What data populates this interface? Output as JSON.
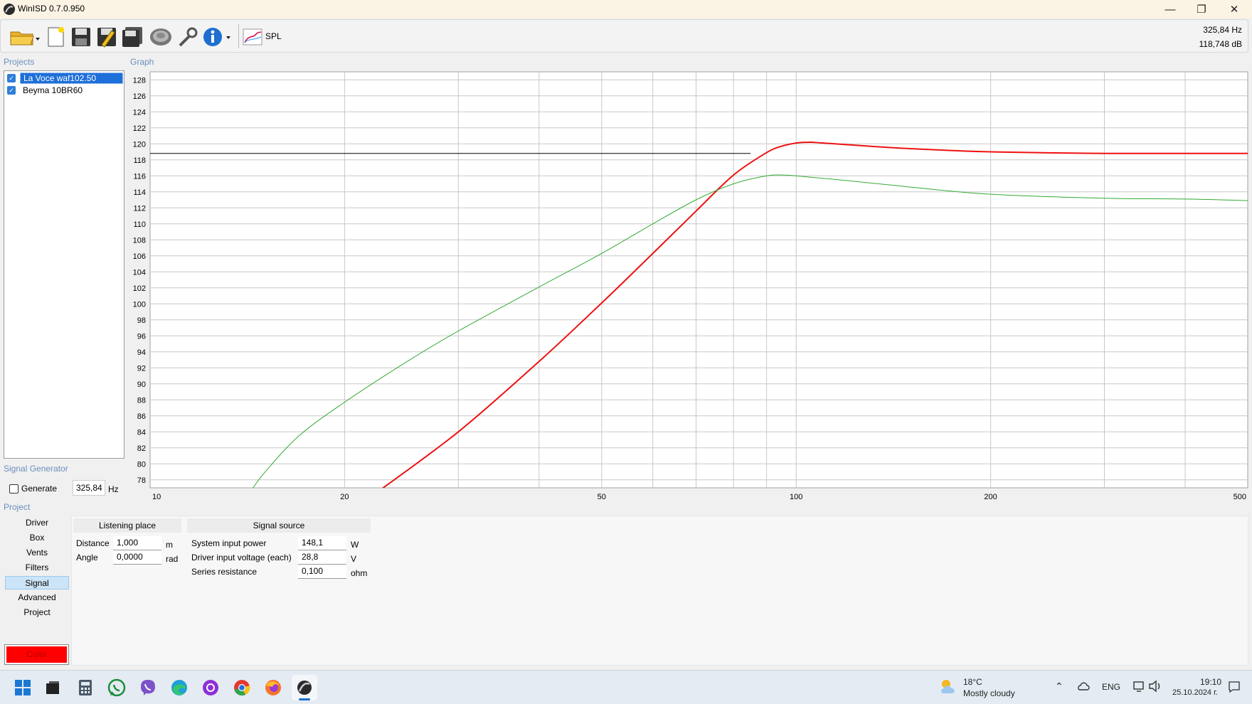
{
  "window": {
    "title": "WinISD 0.7.0.950"
  },
  "toolbar": {
    "spl_label": "SPL",
    "readout_hz": "325,84 Hz",
    "readout_db": "118,748 dB"
  },
  "sections": {
    "projects": "Projects",
    "graph": "Graph",
    "signal_generator": "Signal Generator",
    "project": "Project"
  },
  "projects": [
    {
      "name": "La Voce waf102.50",
      "checked": true,
      "selected": true
    },
    {
      "name": "Beyma 10BR60",
      "checked": true,
      "selected": false
    }
  ],
  "signal_generator": {
    "generate_label": "Generate",
    "frequency": "325,84",
    "unit": "Hz"
  },
  "nav": {
    "items": [
      "Driver",
      "Box",
      "Vents",
      "Filters",
      "Signal",
      "Advanced",
      "Project"
    ],
    "active": "Signal",
    "color_button": "Color"
  },
  "listening_place": {
    "header": "Listening place",
    "distance_label": "Distance",
    "distance_value": "1,000",
    "distance_unit": "m",
    "angle_label": "Angle",
    "angle_value": "0,0000",
    "angle_unit": "rad"
  },
  "signal_source": {
    "header": "Signal source",
    "power_label": "System input power",
    "power_value": "148,1",
    "power_unit": "W",
    "voltage_label": "Driver input voltage (each)",
    "voltage_value": "28,8",
    "voltage_unit": "V",
    "resistance_label": "Series resistance",
    "resistance_value": "0,100",
    "resistance_unit": "ohm"
  },
  "chart_data": {
    "type": "line",
    "xscale": "log",
    "xlim": [
      10,
      500
    ],
    "ylim": [
      77,
      129
    ],
    "x_ticks": [
      10,
      20,
      50,
      100,
      200,
      500
    ],
    "x_ticks_labels": [
      "10",
      "20",
      "50",
      "100",
      "200",
      "500"
    ],
    "y_ticks": [
      78,
      80,
      82,
      84,
      86,
      88,
      90,
      92,
      94,
      96,
      98,
      100,
      102,
      104,
      106,
      108,
      110,
      112,
      114,
      116,
      118,
      120,
      122,
      124,
      126,
      128
    ],
    "grid": true,
    "reference_line": {
      "y": 118.8,
      "x_end": 85,
      "color": "#000000"
    },
    "series": [
      {
        "color": "#ee1111",
        "width": 2,
        "x": [
          22.5,
          30,
          40,
          50,
          60,
          70,
          80,
          90,
          95,
          100,
          105,
          110,
          130,
          150,
          200,
          300,
          400,
          500
        ],
        "y": [
          76.5,
          84,
          92.8,
          100.1,
          106.3,
          111.6,
          116.1,
          118.9,
          119.7,
          120.1,
          120.2,
          120.1,
          119.7,
          119.4,
          119.0,
          118.8,
          118.8,
          118.8
        ]
      },
      {
        "color": "#33aa33",
        "width": 1,
        "x": [
          14.3,
          15,
          17,
          20,
          25,
          30,
          40,
          50,
          60,
          70,
          80,
          90,
          95,
          100,
          120,
          150,
          200,
          300,
          400,
          500
        ],
        "y": [
          76.5,
          78.8,
          83.5,
          87.7,
          92.8,
          96.6,
          102.1,
          106.3,
          110.0,
          113.0,
          115.0,
          116.0,
          116.1,
          116.0,
          115.4,
          114.6,
          113.7,
          113.2,
          113.1,
          112.9
        ]
      }
    ]
  },
  "taskbar": {
    "weather_temp": "18°C",
    "weather_desc": "Mostly cloudy",
    "lang": "ENG",
    "time": "19:10",
    "date": "25.10.2024 г."
  }
}
